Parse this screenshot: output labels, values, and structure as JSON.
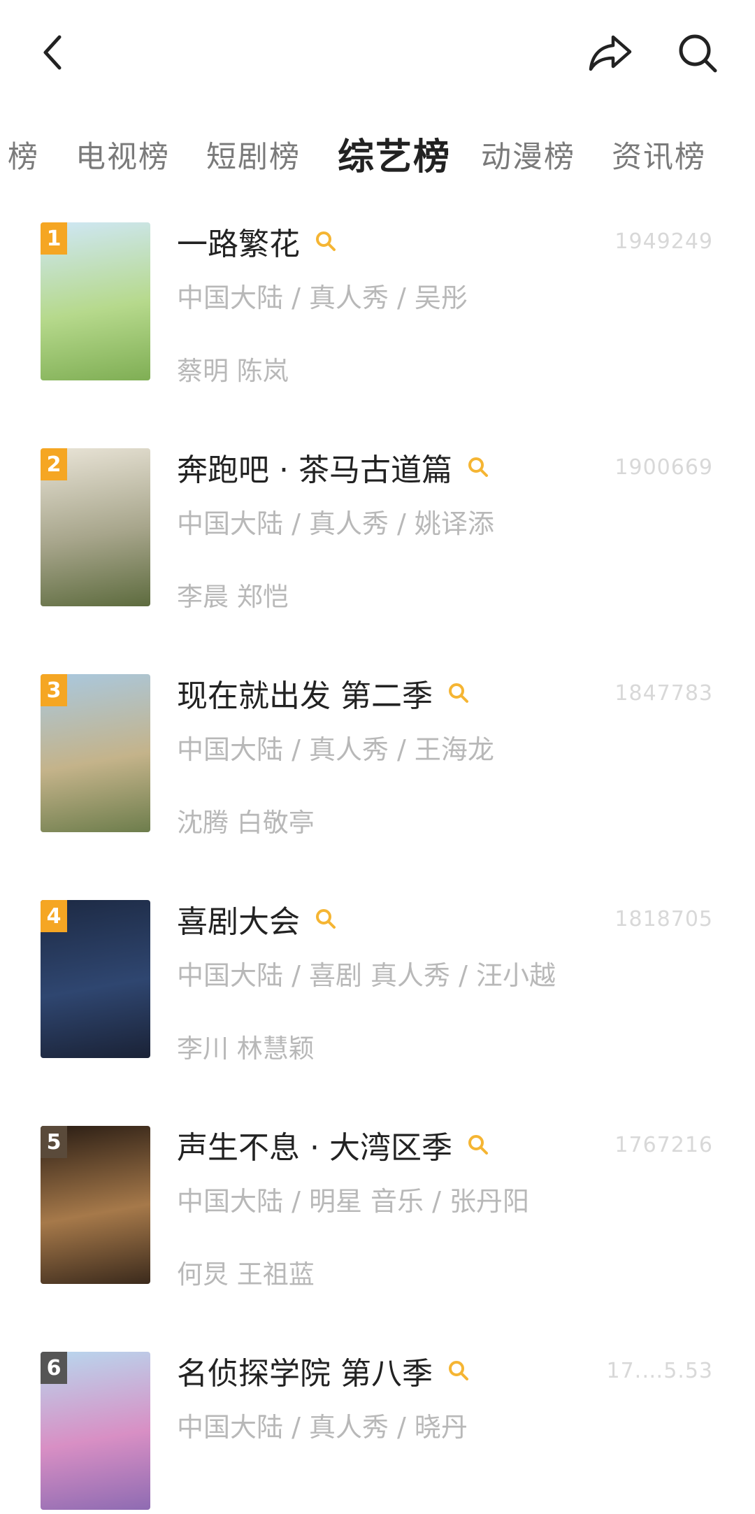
{
  "header": {
    "back_icon": "chevron-left-icon",
    "share_icon": "share-icon",
    "search_icon": "search-icon"
  },
  "tabs": [
    {
      "label": "榜"
    },
    {
      "label": "电视榜"
    },
    {
      "label": "短剧榜"
    },
    {
      "label": "综艺榜",
      "active": true
    },
    {
      "label": "动漫榜"
    },
    {
      "label": "资讯榜"
    }
  ],
  "items": [
    {
      "rank": "1",
      "title": "一路繁花",
      "meta": "中国大陆 / 真人秀 / 吴彤",
      "cast": "蔡明 陈岚",
      "score": "1949249",
      "rank_color": "#f5a623",
      "poster_colors": [
        "#cfe7f6",
        "#b6d98c",
        "#7fae54"
      ]
    },
    {
      "rank": "2",
      "title": "奔跑吧 · 茶马古道篇",
      "meta": "中国大陆 / 真人秀 / 姚译添",
      "cast": "李晨 郑恺",
      "score": "1900669",
      "rank_color": "#f5a623",
      "poster_colors": [
        "#e9e4d7",
        "#a7a58b",
        "#5d6b3e"
      ]
    },
    {
      "rank": "3",
      "title": "现在就出发 第二季",
      "meta": "中国大陆 / 真人秀 / 王海龙",
      "cast": "沈腾 白敬亭",
      "score": "1847783",
      "rank_color": "#f5a623",
      "poster_colors": [
        "#a9c8df",
        "#c4b38a",
        "#6d7d4c"
      ]
    },
    {
      "rank": "4",
      "title": "喜剧大会",
      "meta": "中国大陆 / 喜剧 真人秀 / 汪小越",
      "cast": "李川 林慧颖",
      "score": "1818705",
      "rank_color": "#f5a623",
      "poster_colors": [
        "#1d2a44",
        "#2f4670",
        "#1a2236"
      ]
    },
    {
      "rank": "5",
      "title": "声生不息 · 大湾区季",
      "meta": "中国大陆 / 明星 音乐 / 张丹阳",
      "cast": "何炅 王祖蓝",
      "score": "1767216",
      "rank_color": "#5a4a3a",
      "poster_colors": [
        "#2a1d14",
        "#a6794a",
        "#3b2a1c"
      ]
    },
    {
      "rank": "6",
      "title": "名侦探学院 第八季",
      "meta": "中国大陆 / 真人秀 / 晓丹",
      "cast": "",
      "score": "17.…5.53",
      "rank_color": "#555555",
      "poster_colors": [
        "#b8d7ee",
        "#d88fc4",
        "#8e6bb2"
      ]
    }
  ],
  "colors": {
    "accent": "#f5a623",
    "search_mini": "#f5b533"
  }
}
